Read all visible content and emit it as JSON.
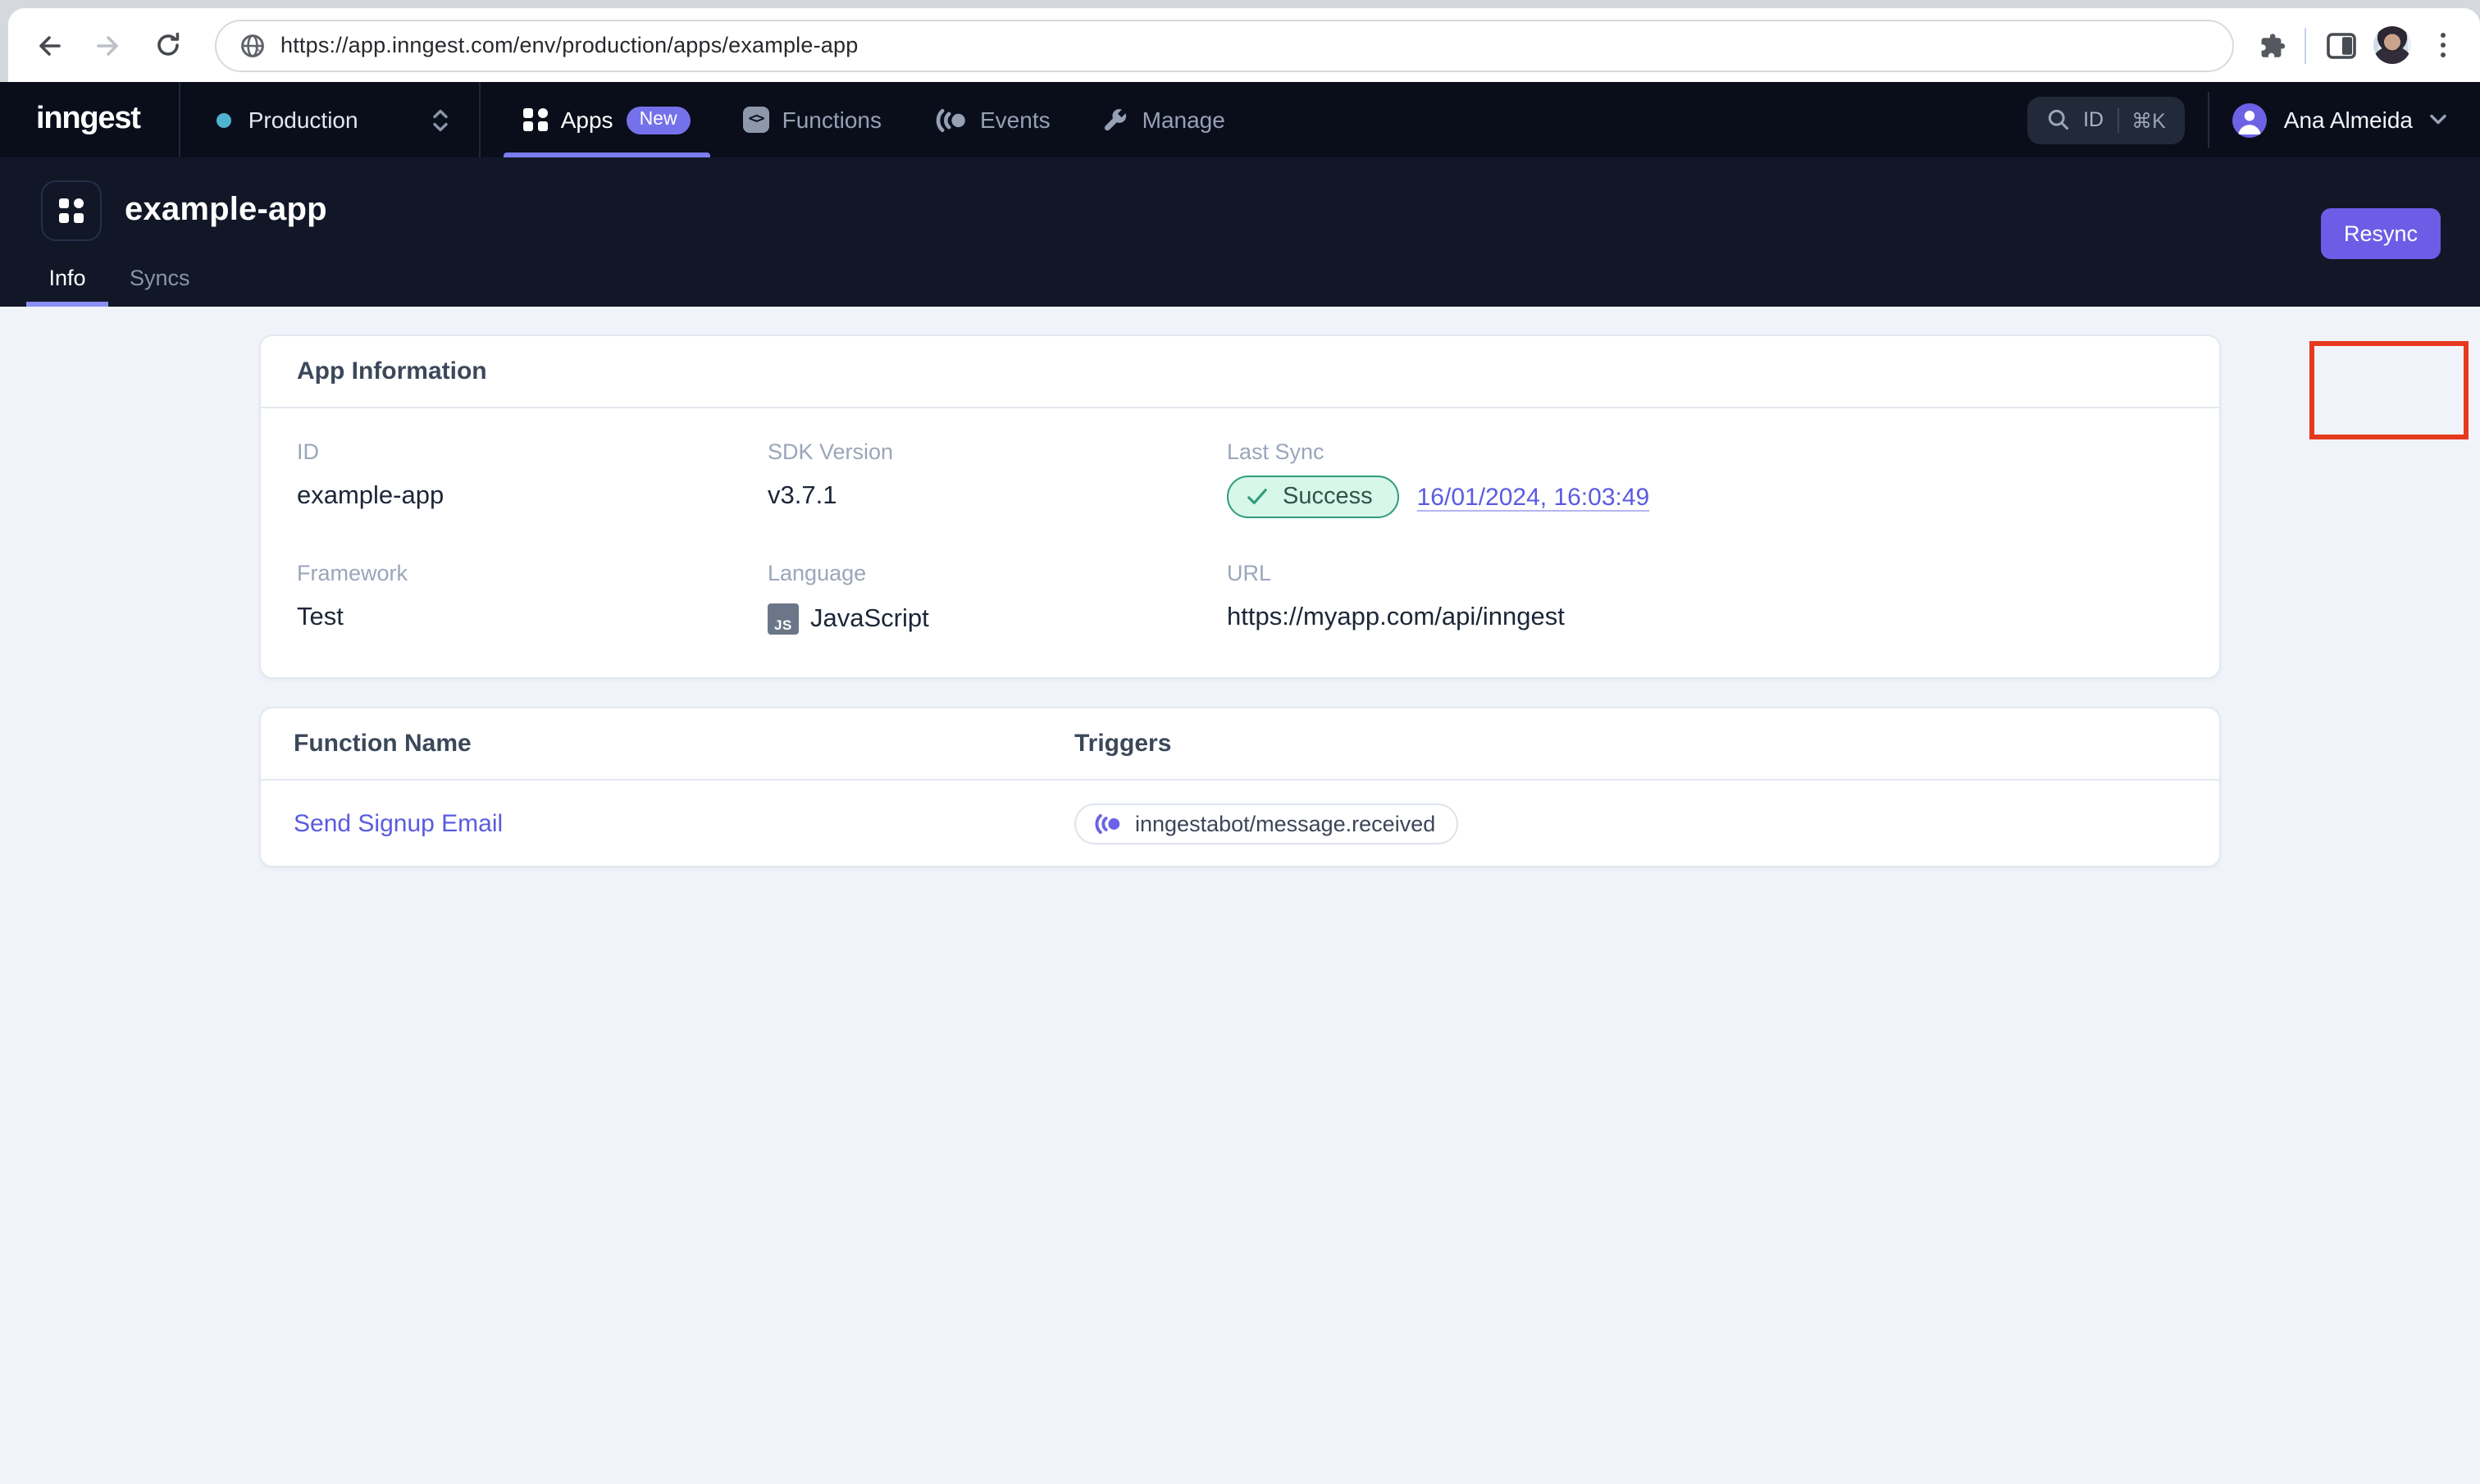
{
  "browser": {
    "url": "https://app.inngest.com/env/production/apps/example-app"
  },
  "navbar": {
    "logo": "inngest",
    "environment": {
      "label": "Production"
    },
    "tabs": [
      {
        "label": "Apps",
        "badge": "New"
      },
      {
        "label": "Functions"
      },
      {
        "label": "Events"
      },
      {
        "label": "Manage"
      }
    ],
    "search": {
      "label": "ID",
      "shortcut": "⌘K"
    },
    "user": {
      "name": "Ana Almeida"
    }
  },
  "header": {
    "title": "example-app",
    "tabs": [
      {
        "label": "Info"
      },
      {
        "label": "Syncs"
      }
    ],
    "resync_label": "Resync"
  },
  "app_info": {
    "title": "App Information",
    "fields": [
      {
        "label": "ID",
        "value": "example-app"
      },
      {
        "label": "SDK Version",
        "value": "v3.7.1"
      },
      {
        "label": "Last Sync",
        "status": "Success",
        "timestamp": "16/01/2024, 16:03:49"
      },
      {
        "label": "Framework",
        "value": "Test"
      },
      {
        "label": "Language",
        "value": "JavaScript",
        "badge": "JS"
      },
      {
        "label": "URL",
        "value": "https://myapp.com/api/inngest"
      }
    ]
  },
  "functions_table": {
    "columns": [
      "Function Name",
      "Triggers"
    ],
    "rows": [
      {
        "name": "Send Signup Email",
        "trigger": "inngestabot/message.received"
      }
    ]
  },
  "icons": {
    "functions_glyph": "<>"
  },
  "colors": {
    "accent_purple": "#6d5de6",
    "link_purple": "#5a5be0",
    "success_green": "#2f9c7c",
    "success_bg": "#d7f7e8",
    "env_dot_teal": "#4db3cf",
    "navbar_bg": "#0a0e1b",
    "header_bg": "#121728",
    "annotation_red": "#e6391e"
  }
}
